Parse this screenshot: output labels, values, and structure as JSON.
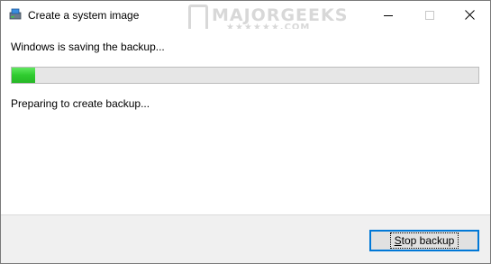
{
  "window": {
    "title": "Create a system image",
    "icon": "backup-drive-icon"
  },
  "watermark": {
    "line1": "MAJORGEEKS",
    "line2": "★★★★★★.COM"
  },
  "titlebar_buttons": {
    "minimize_icon": "minimize-icon",
    "maximize_icon": "maximize-icon",
    "close_icon": "close-icon"
  },
  "status": {
    "main": "Windows is saving the backup...",
    "detail": "Preparing to create backup...",
    "progress_fraction": 0.05,
    "progress_color": "#2fcb2f"
  },
  "footer": {
    "stop_button_accel": "S",
    "stop_button_rest": "top backup"
  }
}
